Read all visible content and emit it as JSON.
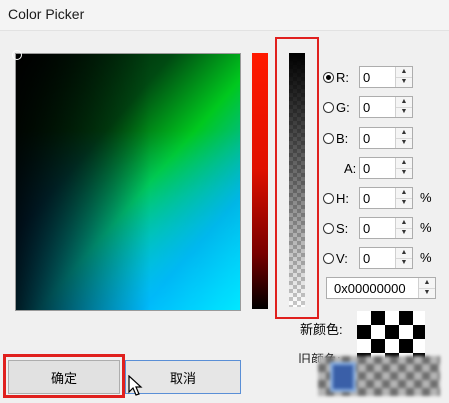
{
  "window": {
    "title": "Color Picker"
  },
  "channels": [
    {
      "id": "r",
      "label": "R:",
      "value": "0",
      "radio": true,
      "checked": true,
      "percent": ""
    },
    {
      "id": "g",
      "label": "G:",
      "value": "0",
      "radio": true,
      "checked": false,
      "percent": ""
    },
    {
      "id": "b",
      "label": "B:",
      "value": "0",
      "radio": true,
      "checked": false,
      "percent": ""
    },
    {
      "id": "a",
      "label": "A:",
      "value": "0",
      "radio": false,
      "checked": false,
      "percent": ""
    },
    {
      "id": "h",
      "label": "H:",
      "value": "0",
      "radio": true,
      "checked": false,
      "percent": "%"
    },
    {
      "id": "s",
      "label": "S:",
      "value": "0",
      "radio": true,
      "checked": false,
      "percent": "%"
    },
    {
      "id": "v",
      "label": "V:",
      "value": "0",
      "radio": true,
      "checked": false,
      "percent": "%"
    }
  ],
  "hex": {
    "value": "0x00000000"
  },
  "preview": {
    "new_label": "新颜色:",
    "old_label": "旧颜色:"
  },
  "buttons": {
    "ok_label": "确定",
    "cancel_label": "取消"
  },
  "colors": {
    "highlight": "#e0201e",
    "focus_border": "#5a8fd6"
  },
  "icons": {
    "up": "spin-up-icon",
    "down": "spin-down-icon",
    "cursor": "mouse-pointer-icon"
  }
}
